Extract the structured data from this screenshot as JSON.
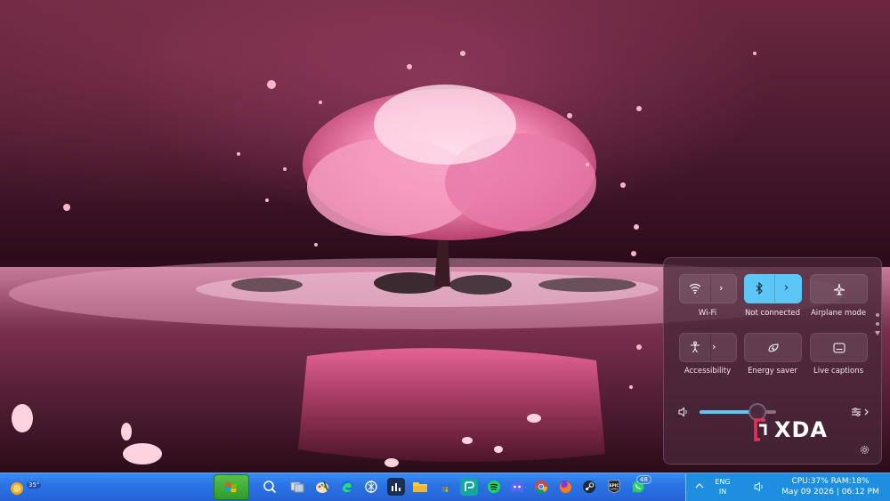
{
  "quick_settings": {
    "tiles": [
      {
        "label": "Wi-Fi",
        "icon": "wifi-icon",
        "active": false,
        "has_arrow": true
      },
      {
        "label": "Not connected",
        "icon": "bluetooth-icon",
        "active": true,
        "has_arrow": true
      },
      {
        "label": "Airplane mode",
        "icon": "airplane-icon",
        "active": false,
        "has_arrow": false
      },
      {
        "label": "Accessibility",
        "icon": "accessibility-icon",
        "active": false,
        "has_arrow": true
      },
      {
        "label": "Energy saver",
        "icon": "energy-saver-icon",
        "active": false,
        "has_arrow": false
      },
      {
        "label": "Live captions",
        "icon": "captions-icon",
        "active": false,
        "has_arrow": false
      }
    ],
    "volume": {
      "icon": "speaker-icon",
      "level": 0.75
    },
    "audio_output_icon": "audio-mixer-icon",
    "settings_icon": "gear-icon",
    "accent_color": "#5cc6f7"
  },
  "watermark": {
    "text": "XDA"
  },
  "taskbar": {
    "weather": {
      "temp": "35°",
      "icon": "weather-sun-icon"
    },
    "start_icon": "windows-xp-logo-icon",
    "apps": [
      "search-icon",
      "task-view-icon",
      "paint-icon",
      "edge-icon",
      "chatgpt-icon",
      "stats-app-icon",
      "file-explorer-icon",
      "store-icon",
      "pc-manager-icon",
      "spotify-icon",
      "discord-icon",
      "chrome-icon",
      "firefox-icon",
      "steam-icon",
      "epic-games-icon",
      "whatsapp-icon"
    ],
    "whatsapp_badge": "48",
    "tray": {
      "language_line1": "ENG",
      "language_line2": "IN",
      "stats": "CPU:37% RAM:18%",
      "datetime": "May 09 2026 | 06:12 PM"
    }
  }
}
